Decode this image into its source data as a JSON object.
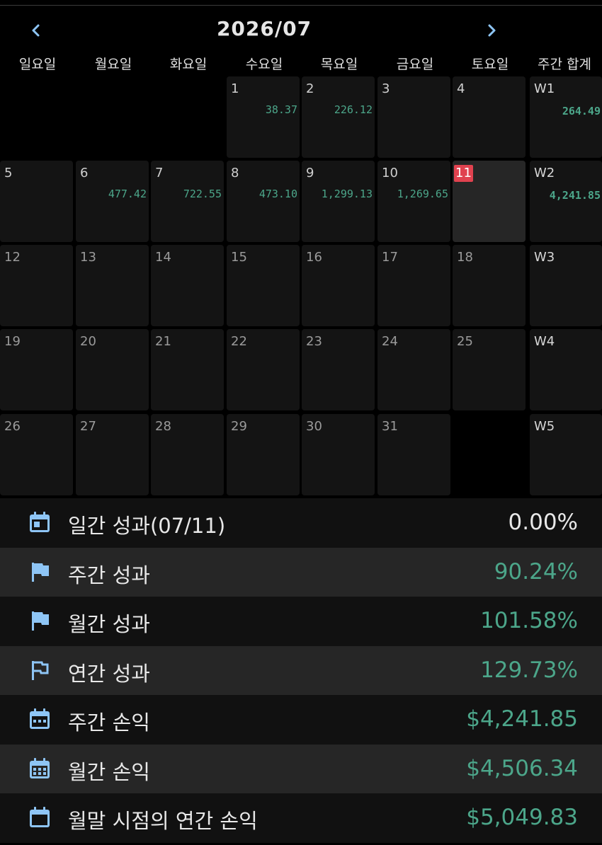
{
  "calendar": {
    "title": "2026/07",
    "weekdays": [
      "일요일",
      "월요일",
      "화요일",
      "수요일",
      "목요일",
      "금요일",
      "토요일",
      "주간 합계"
    ],
    "today": 11,
    "weeks": [
      {
        "label": "W1",
        "total": "264.49",
        "days": [
          null,
          null,
          null,
          {
            "n": "1",
            "pnl": "38.37"
          },
          {
            "n": "2",
            "pnl": "226.12"
          },
          {
            "n": "3",
            "pnl": ""
          },
          {
            "n": "4",
            "pnl": ""
          }
        ]
      },
      {
        "label": "W2",
        "total": "4,241.85",
        "days": [
          {
            "n": "5",
            "pnl": ""
          },
          {
            "n": "6",
            "pnl": "477.42"
          },
          {
            "n": "7",
            "pnl": "722.55"
          },
          {
            "n": "8",
            "pnl": "473.10"
          },
          {
            "n": "9",
            "pnl": "1,299.13"
          },
          {
            "n": "10",
            "pnl": "1,269.65"
          },
          {
            "n": "11",
            "pnl": ""
          }
        ]
      },
      {
        "label": "W3",
        "total": "",
        "days": [
          {
            "n": "12",
            "pnl": ""
          },
          {
            "n": "13",
            "pnl": ""
          },
          {
            "n": "14",
            "pnl": ""
          },
          {
            "n": "15",
            "pnl": ""
          },
          {
            "n": "16",
            "pnl": ""
          },
          {
            "n": "17",
            "pnl": ""
          },
          {
            "n": "18",
            "pnl": ""
          }
        ]
      },
      {
        "label": "W4",
        "total": "",
        "days": [
          {
            "n": "19",
            "pnl": ""
          },
          {
            "n": "20",
            "pnl": ""
          },
          {
            "n": "21",
            "pnl": ""
          },
          {
            "n": "22",
            "pnl": ""
          },
          {
            "n": "23",
            "pnl": ""
          },
          {
            "n": "24",
            "pnl": ""
          },
          {
            "n": "25",
            "pnl": ""
          }
        ]
      },
      {
        "label": "W5",
        "total": "",
        "days": [
          {
            "n": "26",
            "pnl": ""
          },
          {
            "n": "27",
            "pnl": ""
          },
          {
            "n": "28",
            "pnl": ""
          },
          {
            "n": "29",
            "pnl": ""
          },
          {
            "n": "30",
            "pnl": ""
          },
          {
            "n": "31",
            "pnl": ""
          },
          null
        ]
      }
    ]
  },
  "stats": [
    {
      "icon": "calendar-today-icon",
      "label": "일간 성과(07/11)",
      "value": "0.00%",
      "positive": false
    },
    {
      "icon": "flag-filled-icon",
      "label": "주간 성과",
      "value": "90.24%",
      "positive": true
    },
    {
      "icon": "flag-filled-icon",
      "label": "월간 성과",
      "value": "101.58%",
      "positive": true
    },
    {
      "icon": "flag-outline-icon",
      "label": "연간 성과",
      "value": "129.73%",
      "positive": true
    },
    {
      "icon": "calendar-week-icon",
      "label": "주간 손익",
      "value": "$4,241.85",
      "positive": true
    },
    {
      "icon": "calendar-month-icon",
      "label": "월간 손익",
      "value": "$4,506.34",
      "positive": true
    },
    {
      "icon": "calendar-blank-icon",
      "label": "월말 시점의 연간 손익",
      "value": "$5,049.83",
      "positive": true
    }
  ],
  "colors": {
    "accent_green": "#4ca68a",
    "today_red": "#e0424f",
    "icon_blue": "#8ec5f5"
  }
}
